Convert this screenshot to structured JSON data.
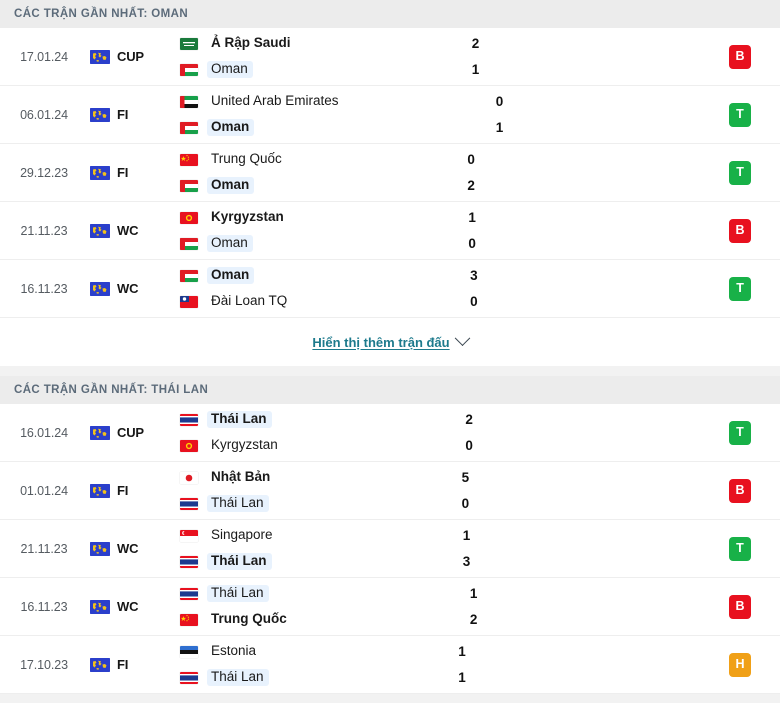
{
  "colors": {
    "win": "#18b148",
    "loss": "#e8111f",
    "draw": "#f0a017",
    "header_text": "#5c6b7a",
    "link": "#1d7a8c",
    "highlight": "#e8f2fd"
  },
  "sections": [
    {
      "id": "oman",
      "header": "CÁC TRẬN GẦN NHẤT: OMAN",
      "comp_icon_name": "world-cup-globe-icon",
      "matches": [
        {
          "date": "17.01.24",
          "competition": "CUP",
          "home": {
            "name": "Ả Rập Saudi",
            "flag": "saudi-arabia",
            "bold": true,
            "highlight": false
          },
          "away": {
            "name": "Oman",
            "flag": "oman",
            "bold": false,
            "highlight": true
          },
          "home_score": "2",
          "away_score": "1",
          "result": "B",
          "result_type": "L"
        },
        {
          "date": "06.01.24",
          "competition": "FI",
          "home": {
            "name": "United Arab Emirates",
            "flag": "uae",
            "bold": false,
            "highlight": false
          },
          "away": {
            "name": "Oman",
            "flag": "oman",
            "bold": true,
            "highlight": true
          },
          "home_score": "0",
          "away_score": "1",
          "result": "T",
          "result_type": "W"
        },
        {
          "date": "29.12.23",
          "competition": "FI",
          "home": {
            "name": "Trung Quốc",
            "flag": "china",
            "bold": false,
            "highlight": false
          },
          "away": {
            "name": "Oman",
            "flag": "oman",
            "bold": true,
            "highlight": true
          },
          "home_score": "0",
          "away_score": "2",
          "result": "T",
          "result_type": "W"
        },
        {
          "date": "21.11.23",
          "competition": "WC",
          "home": {
            "name": "Kyrgyzstan",
            "flag": "kyrgyzstan",
            "bold": true,
            "highlight": false
          },
          "away": {
            "name": "Oman",
            "flag": "oman",
            "bold": false,
            "highlight": true
          },
          "home_score": "1",
          "away_score": "0",
          "result": "B",
          "result_type": "L"
        },
        {
          "date": "16.11.23",
          "competition": "WC",
          "home": {
            "name": "Oman",
            "flag": "oman",
            "bold": true,
            "highlight": true
          },
          "away": {
            "name": "Đài Loan TQ",
            "flag": "taiwan",
            "bold": false,
            "highlight": false
          },
          "home_score": "3",
          "away_score": "0",
          "result": "T",
          "result_type": "W"
        }
      ],
      "show_more": "Hiển thị thêm trận đấu"
    },
    {
      "id": "thailan",
      "header": "CÁC TRẬN GẦN NHẤT: THÁI LAN",
      "comp_icon_name": "world-cup-globe-icon",
      "matches": [
        {
          "date": "16.01.24",
          "competition": "CUP",
          "home": {
            "name": "Thái Lan",
            "flag": "thailand",
            "bold": true,
            "highlight": true
          },
          "away": {
            "name": "Kyrgyzstan",
            "flag": "kyrgyzstan",
            "bold": false,
            "highlight": false
          },
          "home_score": "2",
          "away_score": "0",
          "result": "T",
          "result_type": "W"
        },
        {
          "date": "01.01.24",
          "competition": "FI",
          "home": {
            "name": "Nhật Bản",
            "flag": "japan",
            "bold": true,
            "highlight": false
          },
          "away": {
            "name": "Thái Lan",
            "flag": "thailand",
            "bold": false,
            "highlight": true
          },
          "home_score": "5",
          "away_score": "0",
          "result": "B",
          "result_type": "L"
        },
        {
          "date": "21.11.23",
          "competition": "WC",
          "home": {
            "name": "Singapore",
            "flag": "singapore",
            "bold": false,
            "highlight": false
          },
          "away": {
            "name": "Thái Lan",
            "flag": "thailand",
            "bold": true,
            "highlight": true
          },
          "home_score": "1",
          "away_score": "3",
          "result": "T",
          "result_type": "W"
        },
        {
          "date": "16.11.23",
          "competition": "WC",
          "home": {
            "name": "Thái Lan",
            "flag": "thailand",
            "bold": false,
            "highlight": true
          },
          "away": {
            "name": "Trung Quốc",
            "flag": "china",
            "bold": true,
            "highlight": false
          },
          "home_score": "1",
          "away_score": "2",
          "result": "B",
          "result_type": "L"
        },
        {
          "date": "17.10.23",
          "competition": "FI",
          "home": {
            "name": "Estonia",
            "flag": "estonia",
            "bold": false,
            "highlight": false
          },
          "away": {
            "name": "Thái Lan",
            "flag": "thailand",
            "bold": false,
            "highlight": true
          },
          "home_score": "1",
          "away_score": "1",
          "result": "H",
          "result_type": "D"
        }
      ],
      "show_more": null
    }
  ]
}
